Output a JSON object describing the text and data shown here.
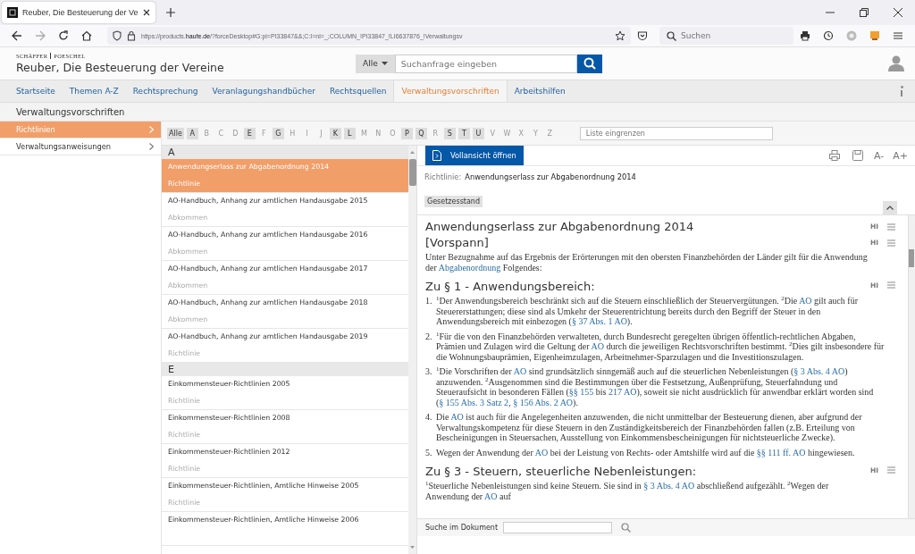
{
  "browser": {
    "tab": {
      "title": "Reuber, Die Besteuerung der Ve"
    },
    "url": {
      "before": "https://products.",
      "domain": "haufe.de",
      "after": "/?forceDesktop#G:pi=PI33847&&;C:I=nl=_;COLUMN_!PI33847_!LI6637876_!Verwaltungsv"
    },
    "search_placeholder": "Suchen"
  },
  "site": {
    "publisher": [
      "SCHÄFFER",
      "POESCHEL"
    ],
    "title": "Reuber, Die Besteuerung der Vereine",
    "search": {
      "scope": "Alle",
      "placeholder": "Suchanfrage eingeben"
    }
  },
  "nav": [
    {
      "label": "Startseite",
      "selected": false
    },
    {
      "label": "Themen A-Z",
      "selected": false
    },
    {
      "label": "Rechtsprechung",
      "selected": false
    },
    {
      "label": "Veranlagungshandbücher",
      "selected": false
    },
    {
      "label": "Rechtsquellen",
      "selected": false
    },
    {
      "label": "Verwaltungsvorschriften",
      "selected": true
    },
    {
      "label": "Arbeitshilfen",
      "selected": false
    }
  ],
  "section_title": "Verwaltungsvorschriften",
  "sidebar": {
    "items": [
      {
        "label": "Richtlinien",
        "selected": true
      },
      {
        "label": "Verwaltungsanweisungen",
        "selected": false
      }
    ]
  },
  "letters": [
    {
      "label": "Alle",
      "enabled": true
    },
    {
      "label": "A",
      "enabled": true
    },
    {
      "label": "B",
      "enabled": false
    },
    {
      "label": "C",
      "enabled": false
    },
    {
      "label": "D",
      "enabled": false
    },
    {
      "label": "E",
      "enabled": true
    },
    {
      "label": "F",
      "enabled": false
    },
    {
      "label": "G",
      "enabled": true
    },
    {
      "label": "H",
      "enabled": false
    },
    {
      "label": "I",
      "enabled": false
    },
    {
      "label": "J",
      "enabled": false
    },
    {
      "label": "K",
      "enabled": true
    },
    {
      "label": "L",
      "enabled": true
    },
    {
      "label": "M",
      "enabled": false
    },
    {
      "label": "N",
      "enabled": false
    },
    {
      "label": "O",
      "enabled": false
    },
    {
      "label": "P",
      "enabled": true
    },
    {
      "label": "Q",
      "enabled": true
    },
    {
      "label": "R",
      "enabled": false
    },
    {
      "label": "S",
      "enabled": true
    },
    {
      "label": "T",
      "enabled": true
    },
    {
      "label": "U",
      "enabled": true
    },
    {
      "label": "V",
      "enabled": false
    },
    {
      "label": "W",
      "enabled": false
    },
    {
      "label": "X",
      "enabled": false
    },
    {
      "label": "Y",
      "enabled": false
    },
    {
      "label": "Z",
      "enabled": false
    }
  ],
  "filter": {
    "placeholder": "Liste eingrenzen"
  },
  "list": {
    "groups": [
      {
        "letter": "A",
        "items": [
          {
            "title": "Anwendungserlass zur Abgabenordnung 2014",
            "type": "Richtlinie",
            "selected": true
          },
          {
            "title": "AO-Handbuch, Anhang zur amtlichen Handausgabe 2015",
            "type": "Abkommen",
            "selected": false
          },
          {
            "title": "AO-Handbuch, Anhang zur amtlichen Handausgabe 2016",
            "type": "Abkommen",
            "selected": false
          },
          {
            "title": "AO-Handbuch, Anhang zur amtlichen Handausgabe 2017",
            "type": "Abkommen",
            "selected": false
          },
          {
            "title": "AO-Handbuch, Anhang zur amtlichen Handausgabe 2018",
            "type": "Abkommen",
            "selected": false
          },
          {
            "title": "AO-Handbuch, Anhang zur amtlichen Handausgabe 2019",
            "type": "Richtlinie",
            "selected": false
          }
        ]
      },
      {
        "letter": "E",
        "items": [
          {
            "title": "Einkommensteuer-Richtlinien 2005",
            "type": "Richtlinie",
            "selected": false
          },
          {
            "title": "Einkommensteuer-Richtlinien 2008",
            "type": "Richtlinie",
            "selected": false
          },
          {
            "title": "Einkommensteuer-Richtlinien 2012",
            "type": "Richtlinie",
            "selected": false
          },
          {
            "title": "Einkommensteuer-Richtlinien, Amtliche Hinweise 2005",
            "type": "Richtlinie",
            "selected": false
          },
          {
            "title": "Einkommensteuer-Richtlinien, Amtliche Hinweise 2006",
            "selected": false
          }
        ]
      }
    ]
  },
  "document": {
    "open_button": "Vollansicht öffnen",
    "font_buttons": [
      "A-",
      "A+"
    ],
    "meta_label": "Richtlinie:",
    "meta_value": "Anwendungserlass zur Abgabenordnung 2014",
    "tag": "Gesetzesstand",
    "blocks": [
      {
        "kind": "title",
        "text": "Anwendungserlass zur Abgabenordnung 2014",
        "marker": "HI"
      },
      {
        "kind": "subtitle",
        "text": "[Vorspann]",
        "marker": "HI"
      },
      {
        "kind": "paragraph",
        "segments": [
          {
            "kind": "text",
            "text": "Unter Bezugnahme auf das Ergebnis der Erörterungen mit den obersten Finanzbehörden der Länder gilt für die Anwendung der "
          },
          {
            "kind": "link",
            "text": "Abgabenordnung"
          },
          {
            "kind": "text",
            "text": " Folgendes:"
          }
        ]
      },
      {
        "kind": "heading",
        "text": "Zu § 1 - Anwendungsbereich:",
        "marker": "HI"
      },
      {
        "kind": "item",
        "number": "1.",
        "segments": [
          {
            "kind": "text",
            "text": "$^{1}$Der Anwendungsbereich beschränkt sich auf die Steuern einschließlich der Steuervergütungen. $^{2}$Die "
          },
          {
            "kind": "link",
            "text": "AO"
          },
          {
            "kind": "text",
            "text": " gilt auch für Steuererstattungen; diese sind als Umkehr der Steuerentrichtung bereits durch den Begriff der Steuer in den Anwendungsbereich mit einbezogen ("
          },
          {
            "kind": "link",
            "text": "§ 37 Abs. 1 AO"
          },
          {
            "kind": "text",
            "text": ")."
          }
        ]
      },
      {
        "kind": "item",
        "number": "2.",
        "segments": [
          {
            "kind": "text",
            "text": "$^{1}$Für die von den Finanzbehörden verwalteten, durch Bundesrecht geregelten übrigen öffentlich-rechtlichen Abgaben, Prämien und Zulagen wird die Geltung der "
          },
          {
            "kind": "link",
            "text": "AO"
          },
          {
            "kind": "text",
            "text": " durch die jeweiligen Rechtsvorschriften bestimmt. $^{2}$Dies gilt insbesondere für die Wohnungsbauprämien, Eigenheimzulagen, Arbeitnehmer-Sparzulagen und die Investitionszulagen."
          }
        ]
      },
      {
        "kind": "item",
        "number": "3.",
        "segments": [
          {
            "kind": "text",
            "text": "$^{1}$Die Vorschriften der "
          },
          {
            "kind": "link",
            "text": "AO"
          },
          {
            "kind": "text",
            "text": " sind grundsätzlich sinngemäß auch auf die steuerlichen Nebenleistungen ("
          },
          {
            "kind": "link",
            "text": "§ 3 Abs. 4 AO"
          },
          {
            "kind": "text",
            "text": ") anzuwenden. $^{2}$Ausgenommen sind die Bestimmungen über die Festsetzung, Außenprüfung, Steuerfahndung und Steueraufsicht in besonderen Fällen ("
          },
          {
            "kind": "link",
            "text": "§§ 155"
          },
          {
            "kind": "text",
            "text": " bis "
          },
          {
            "kind": "link",
            "text": "217 AO"
          },
          {
            "kind": "text",
            "text": "), soweit sie nicht ausdrücklich für anwendbar erklärt worden sind ("
          },
          {
            "kind": "link",
            "text": "§ 155 Abs. 3 Satz 2"
          },
          {
            "kind": "text",
            "text": ", "
          },
          {
            "kind": "link",
            "text": "§ 156 Abs. 2 AO"
          },
          {
            "kind": "text",
            "text": ")."
          }
        ]
      },
      {
        "kind": "item",
        "number": "4.",
        "segments": [
          {
            "kind": "text",
            "text": "Die "
          },
          {
            "kind": "link",
            "text": "AO"
          },
          {
            "kind": "text",
            "text": " ist auch für die Angelegenheiten anzuwenden, die nicht unmittelbar der Besteuerung dienen, aber aufgrund der Verwaltungskompetenz für diese Steuern in den Zuständigkeitsbereich der Finanzbehörden fallen (z.B. Erteilung von Bescheinigungen in Steuersachen, Ausstellung von Einkommensbescheinigungen für nichtsteuerliche Zwecke)."
          }
        ]
      },
      {
        "kind": "item",
        "number": "5.",
        "segments": [
          {
            "kind": "text",
            "text": "Wegen der Anwendung der "
          },
          {
            "kind": "link",
            "text": "AO"
          },
          {
            "kind": "text",
            "text": " bei der Leistung von Rechts- oder Amtshilfe wird auf die "
          },
          {
            "kind": "link",
            "text": "§§ 111 ff. AO"
          },
          {
            "kind": "text",
            "text": " hingewiesen."
          }
        ]
      },
      {
        "kind": "heading",
        "text": "Zu § 3 - Steuern, steuerliche Nebenleistungen:",
        "marker": "HI"
      },
      {
        "kind": "paragraph",
        "segments": [
          {
            "kind": "text",
            "text": "$^{1}$Steuerliche Nebenleistungen sind keine Steuern. Sie sind in "
          },
          {
            "kind": "link",
            "text": "§ 3 Abs. 4 AO"
          },
          {
            "kind": "text",
            "text": " abschließend aufgezählt. $^{2}$Wegen der Anwendung der "
          },
          {
            "kind": "link",
            "text": "AO"
          },
          {
            "kind": "text",
            "text": " auf"
          }
        ]
      }
    ],
    "search_label": "Suche im Dokument"
  }
}
